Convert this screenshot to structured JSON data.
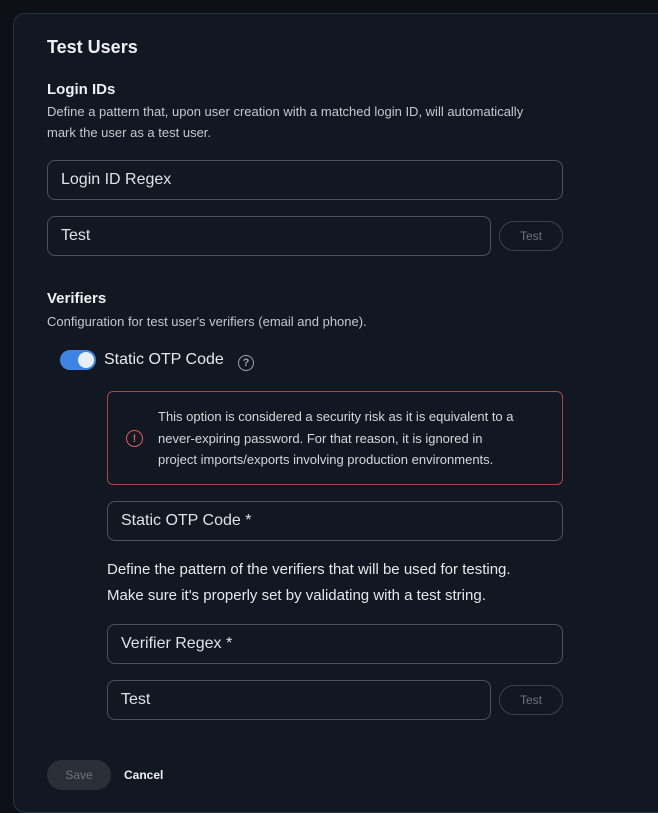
{
  "header": {
    "title": "Test Users"
  },
  "login_ids": {
    "title": "Login IDs",
    "description_line1": "Define a pattern that, upon user creation with a matched login ID, will automatically",
    "description_line2": "mark the user as a test user.",
    "regex_placeholder": "Login ID Regex",
    "test_placeholder": "Test",
    "test_button": "Test"
  },
  "verifiers": {
    "title": "Verifiers",
    "description": "Configuration for test user's verifiers (email and phone).",
    "static_otp_toggle": {
      "label": "Static OTP Code",
      "enabled": true
    },
    "help_icon": "question-circle-icon",
    "warning": {
      "icon": "alert-circle-icon",
      "line1": "This option is considered a security risk as it is equivalent to a",
      "line2": "never-expiring password. For that reason, it is ignored in",
      "line3": "project imports/exports involving production environments."
    },
    "static_otp_placeholder": "Static OTP Code *",
    "pattern_desc_line1": "Define the pattern of the verifiers that will be used for testing.",
    "pattern_desc_line2": "Make sure it's properly set by validating with a test string.",
    "regex_placeholder": "Verifier Regex *",
    "test_placeholder": "Test",
    "test_button": "Test"
  },
  "footer": {
    "save_label": "Save",
    "cancel_label": "Cancel"
  },
  "colors": {
    "background": "#0d1117",
    "card": "#111821",
    "accent": "#3f84e5",
    "danger": "#e05a5c"
  }
}
